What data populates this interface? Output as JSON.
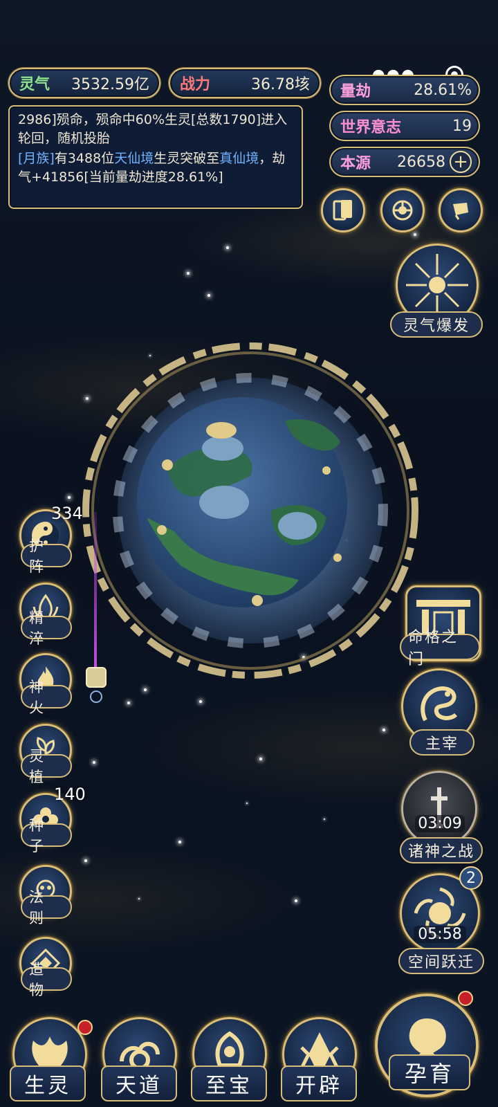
{
  "resources": {
    "lingqi": {
      "label": "灵气",
      "value": "3532.59亿"
    },
    "zhanli": {
      "label": "战力",
      "value": "36.78垓"
    }
  },
  "log": {
    "line1": "2986]殒命，殒命中60%生灵[总数1790]进入轮回，随机投胎",
    "line2_prefix": "[月族]",
    "line2_a": "有3488位",
    "line2_realm1": "天仙境",
    "line2_b": "生灵突破至",
    "line2_realm2": "真仙境",
    "line2_c": "，劫气+41856[当前量劫进度28.61%]"
  },
  "world_stats": {
    "liangjie": {
      "label": "量劫",
      "value": "28.61%"
    },
    "shijie_yizhi": {
      "label": "世界意志",
      "value": "19"
    },
    "benyuan": {
      "label": "本源",
      "value": "26658"
    }
  },
  "right_actions": {
    "burst": "灵气爆发",
    "mingge": "命格之门",
    "zhuzai": "主宰",
    "zhushen": {
      "label": "诸神之战",
      "timer": "03:09"
    },
    "kongjian": {
      "label": "空间跃迁",
      "timer": "05:58",
      "badge": "2"
    }
  },
  "left_actions": {
    "huzhen": {
      "label": "护 阵",
      "badge": "334"
    },
    "jingcui": {
      "label": "精 淬"
    },
    "shenhuo": {
      "label": "神 火"
    },
    "lingzhi": {
      "label": "灵 植"
    },
    "zhongzi": {
      "label": "种 子",
      "badge": "140"
    },
    "faze": {
      "label": "法 则"
    },
    "zaowu": {
      "label": "造 物"
    }
  },
  "bottom_nav": {
    "shengling": "生灵",
    "tiandao": "天道",
    "zhibao": "至宝",
    "kaipi": "开辟",
    "yunyu": "孕育"
  },
  "colors": {
    "gold": "#d8bd7a",
    "panel": "#1d2d4b",
    "highlight_blue": "#6fb3ff",
    "red_dot": "#c6202a"
  }
}
